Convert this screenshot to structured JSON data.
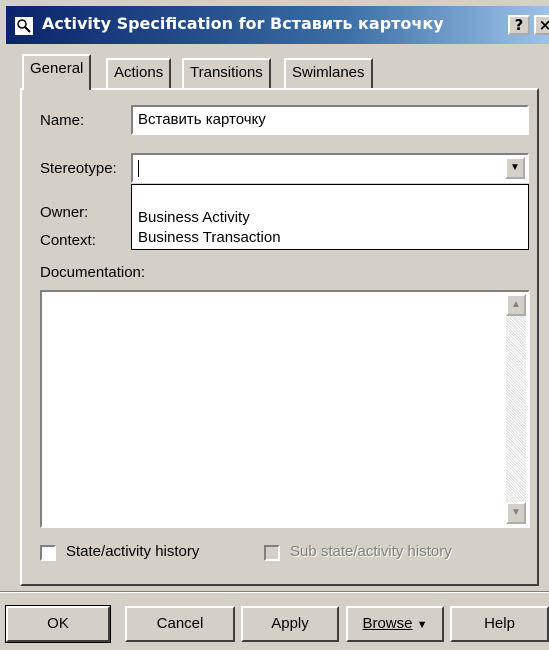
{
  "window": {
    "title": "Activity Specification for Вставить карточку",
    "help_button": "?",
    "close_button": "×"
  },
  "tabs": [
    {
      "label": "General",
      "active": true
    },
    {
      "label": "Actions",
      "active": false
    },
    {
      "label": "Transitions",
      "active": false
    },
    {
      "label": "Swimlanes",
      "active": false
    }
  ],
  "general": {
    "name_label": "Name:",
    "name_value": "Вставить карточку",
    "stereotype_label": "Stereotype:",
    "stereotype_value": "",
    "stereotype_options": [
      "Business Activity",
      "Business Transaction"
    ],
    "owner_label": "Owner:",
    "context_label": "Context:",
    "documentation_label": "Documentation:",
    "documentation_value": ""
  },
  "checkboxes": {
    "state_history": {
      "label": "State/activity history",
      "checked": false,
      "enabled": true
    },
    "sub_state_history": {
      "label": "Sub state/activity history",
      "checked": false,
      "enabled": false
    }
  },
  "buttons": {
    "ok": "OK",
    "cancel": "Cancel",
    "apply": "Apply",
    "browse": "Browse",
    "browse_arrow": "▼",
    "help": "Help"
  },
  "icons": {
    "title_icon": "activity-magnifier-icon",
    "dropdown_arrow": "▼",
    "scroll_up": "▲",
    "scroll_down": "▼"
  }
}
